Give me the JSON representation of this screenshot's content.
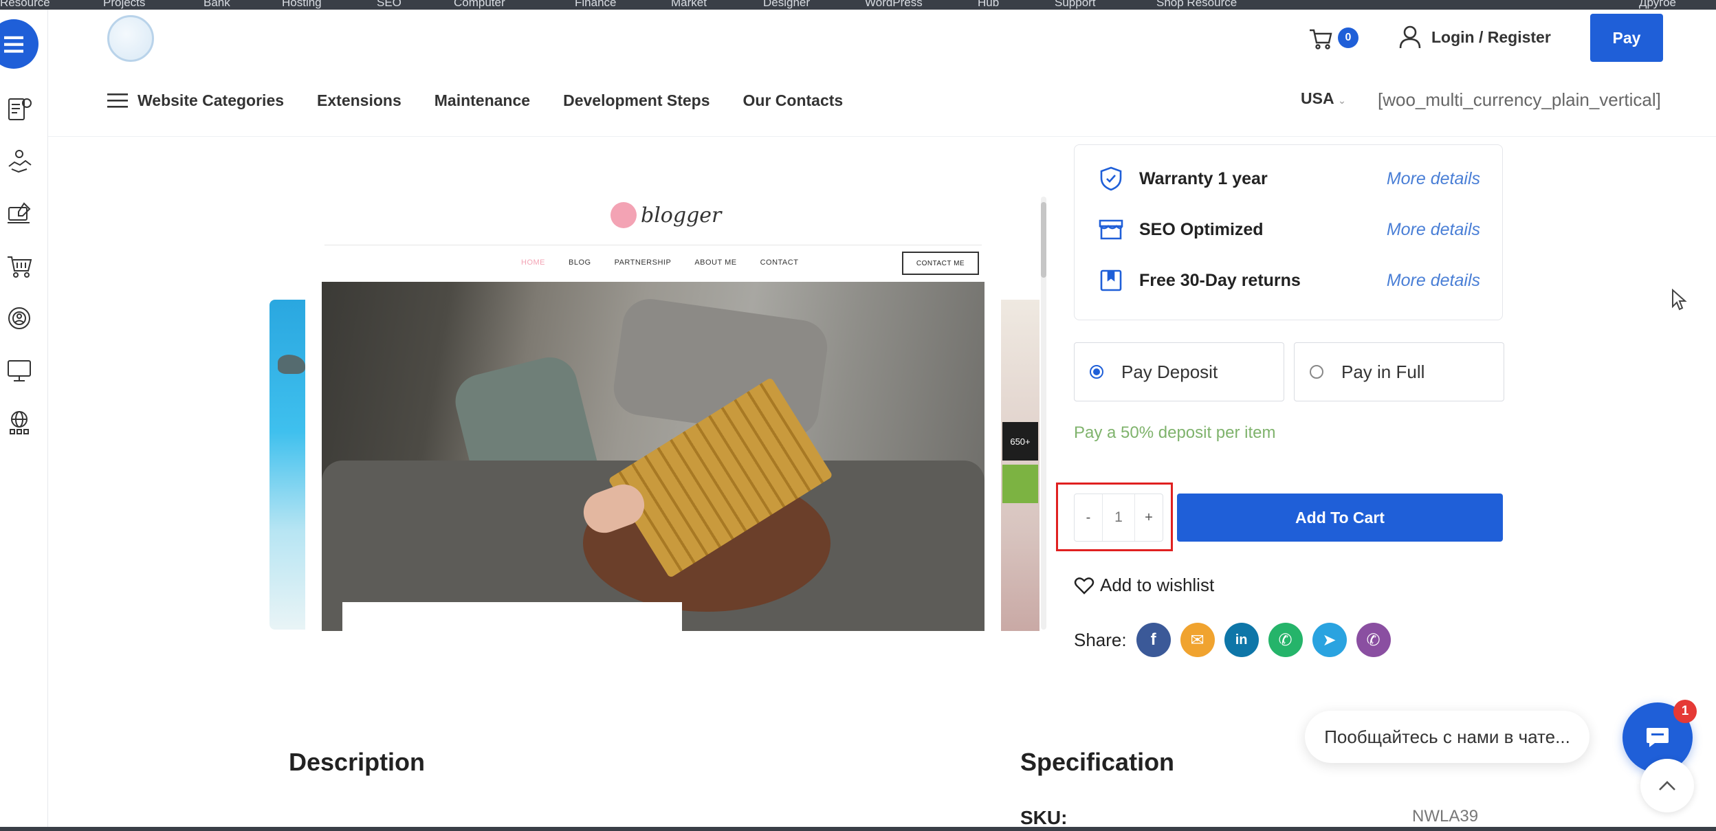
{
  "top_strip": {
    "items": [
      "Resource",
      "Projects",
      "Bank",
      "Hosting",
      "SEO",
      "Computer",
      "Finance",
      "Market",
      "Designer",
      "WordPress",
      "Hub",
      "Support",
      "Shop Resource",
      "Другое"
    ]
  },
  "header": {
    "cart_count": "0",
    "login_label": "Login / Register",
    "pay_label": "Pay"
  },
  "nav": {
    "categories_label": "Website Categories",
    "items": [
      "Extensions",
      "Maintenance",
      "Development Steps",
      "Our Contacts"
    ],
    "currency": "USA",
    "currency_caret": "⌄",
    "currency_switcher": "[woo_multi_currency_plain_vertical]"
  },
  "sidebar": {
    "icons": [
      "menu-icon",
      "price-list-icon",
      "handshake-icon",
      "edit-laptop-icon",
      "shopping-cart-icon",
      "support-agent-icon",
      "monitor-icon",
      "globe-network-icon"
    ]
  },
  "preview": {
    "logo_text": "blogger",
    "menu": [
      "HOME",
      "BLOG",
      "PARTNERSHIP",
      "ABOUT ME",
      "CONTACT"
    ],
    "contact_button": "CONTACT ME",
    "side_badge": "650+"
  },
  "features": [
    {
      "label": "Warranty 1 year",
      "link": "More details",
      "icon": "shield-check-icon"
    },
    {
      "label": "SEO Optimized",
      "link": "More details",
      "icon": "storefront-icon"
    },
    {
      "label": "Free 30-Day returns",
      "link": "More details",
      "icon": "bookmark-box-icon"
    }
  ],
  "payment": {
    "options": [
      {
        "label": "Pay Deposit",
        "selected": true
      },
      {
        "label": "Pay in Full",
        "selected": false
      }
    ],
    "note": "Pay a 50% deposit per item"
  },
  "quantity": {
    "minus": "-",
    "value": "1",
    "plus": "+"
  },
  "add_to_cart": "Add To Cart",
  "wishlist": "Add to wishlist",
  "share": {
    "label": "Share:",
    "networks": [
      {
        "name": "facebook-icon",
        "glyph": "f",
        "color": "#3b5998"
      },
      {
        "name": "email-icon",
        "glyph": "✉",
        "color": "#f0a32f"
      },
      {
        "name": "linkedin-icon",
        "glyph": "in",
        "color": "#0e76a8"
      },
      {
        "name": "whatsapp-icon",
        "glyph": "✆",
        "color": "#25b46a"
      },
      {
        "name": "telegram-icon",
        "glyph": "➤",
        "color": "#2aa3e0"
      },
      {
        "name": "viber-icon",
        "glyph": "✆",
        "color": "#8a4fa1"
      }
    ]
  },
  "sections": {
    "description": "Description",
    "specification": "Specification",
    "sku_label": "SKU:",
    "sku_value": "NWLA39"
  },
  "chat": {
    "bubble": "Пообщайтесь с нами в чате...",
    "badge": "1"
  },
  "colors": {
    "accent": "#1f5fd8",
    "link": "#4a7fd6",
    "deposit_note": "#7fb36c",
    "highlight": "#e02020"
  }
}
